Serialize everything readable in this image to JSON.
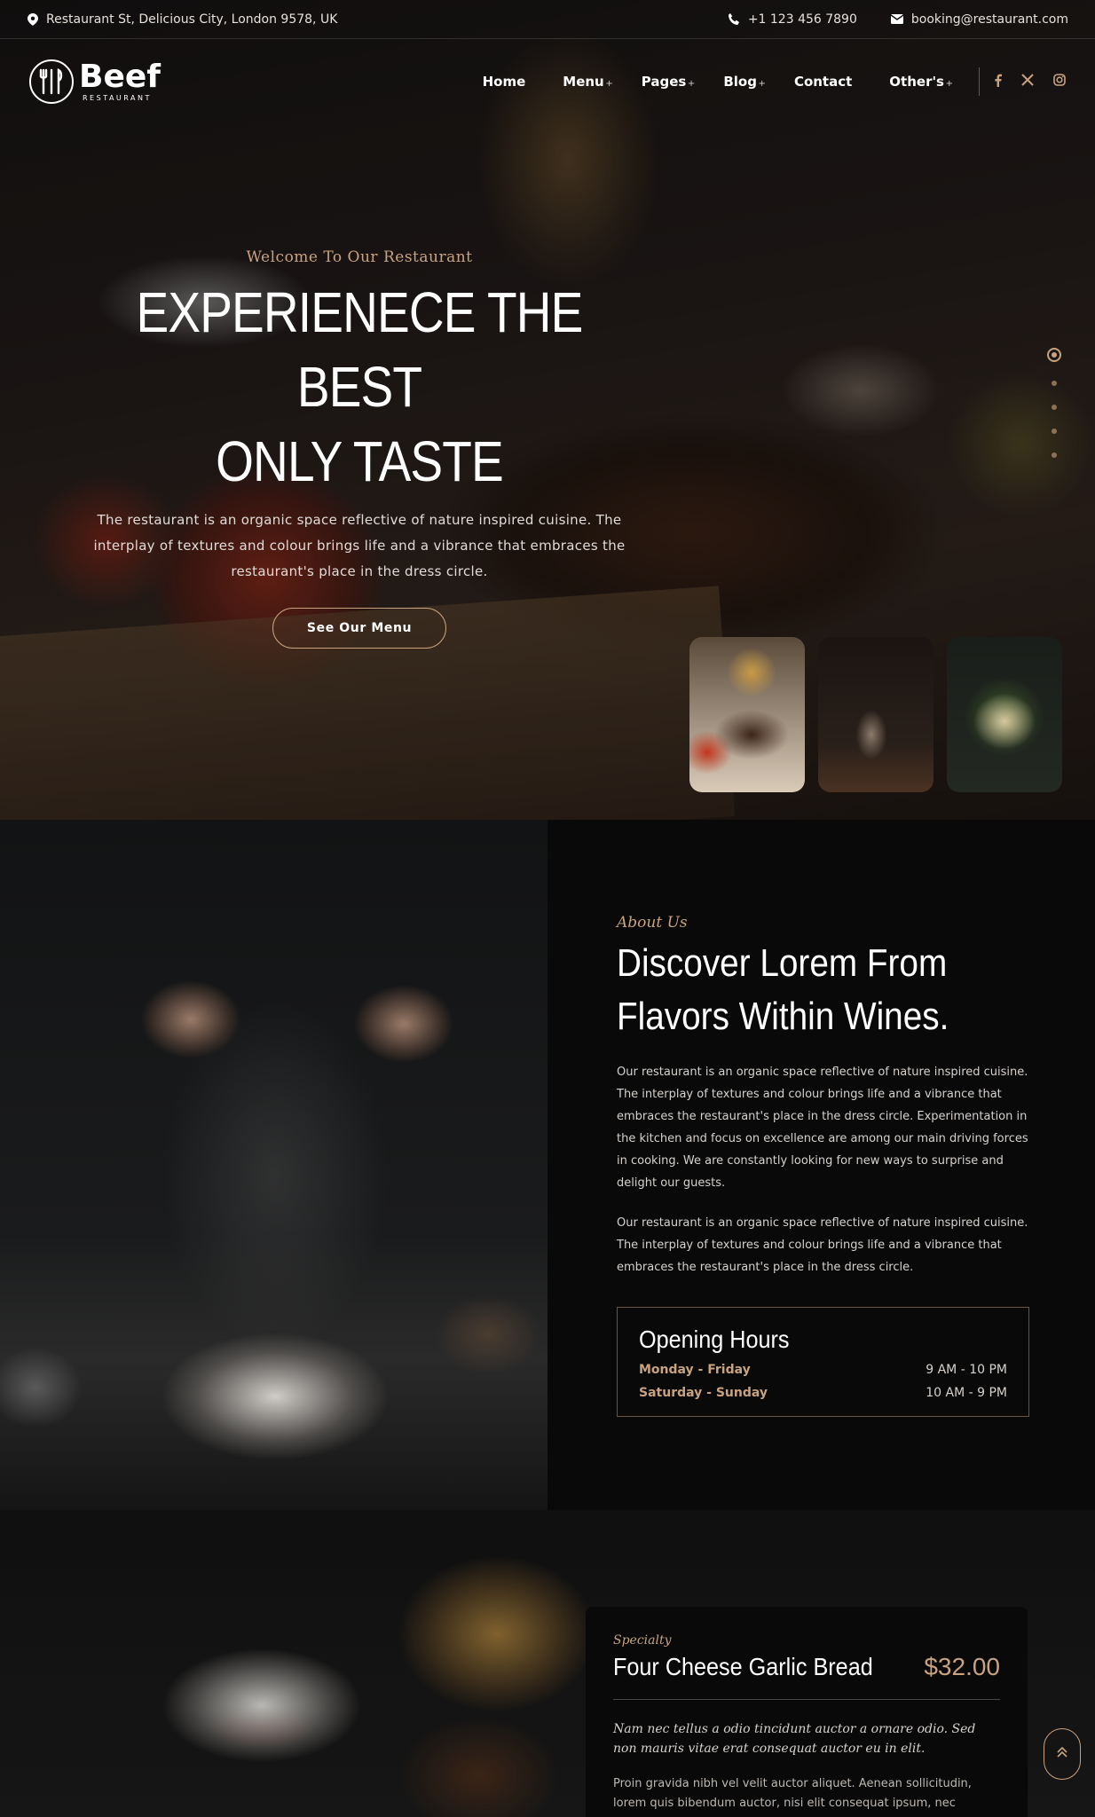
{
  "topbar": {
    "address": "Restaurant St, Delicious City, London 9578, UK",
    "phone": "+1 123 456 7890",
    "email": "booking@restaurant.com",
    "icons": {
      "address": "map-pin-icon",
      "phone": "phone-icon",
      "email": "envelope-icon"
    }
  },
  "brand": {
    "name": "Beef",
    "tagline": "RESTAURANT"
  },
  "nav": {
    "items": [
      {
        "label": "Home",
        "dropdown": false
      },
      {
        "label": "Menu",
        "dropdown": true
      },
      {
        "label": "Pages",
        "dropdown": true
      },
      {
        "label": "Blog",
        "dropdown": true
      },
      {
        "label": "Contact",
        "dropdown": false
      },
      {
        "label": "Other's",
        "dropdown": true
      }
    ],
    "social": [
      "facebook-icon",
      "x-icon",
      "instagram-icon"
    ]
  },
  "hero": {
    "welcome": "Welcome To Our Restaurant",
    "title_line1": "EXPERIENECE THE BEST",
    "title_line2": "ONLY TASTE",
    "description": "The restaurant is an organic space reflective of nature inspired cuisine. The interplay of textures and colour brings life and a vibrance that embraces the restaurant's place in the dress circle.",
    "cta": "See Our Menu",
    "slides": 5,
    "active_slide": 1
  },
  "about": {
    "eyebrow": "About Us",
    "title": "Discover Lorem From Flavors Within Wines.",
    "paragraph1": "Our restaurant is an organic space reflective of nature inspired cuisine. The interplay of textures and colour brings life and a vibrance that embraces the restaurant's place in the dress circle. Experimentation in the kitchen and focus on excellence are among our main driving forces in cooking. We are constantly looking for new ways to surprise and delight our guests.",
    "paragraph2": "Our restaurant is an organic space reflective of nature inspired cuisine. The interplay of textures and colour brings life and a vibrance that embraces the restaurant's place in the dress circle.",
    "hours": {
      "title": "Opening Hours",
      "rows": [
        {
          "day": "Monday - Friday",
          "time": "9 AM - 10 PM"
        },
        {
          "day": "Saturday - Sunday",
          "time": "10 AM - 9 PM"
        }
      ]
    }
  },
  "specialty": {
    "eyebrow": "Specialty",
    "name": "Four Cheese Garlic Bread",
    "price": "$32.00",
    "quote": "Nam nec tellus a odio tincidunt auctor a ornare odio. Sed non mauris vitae erat consequat auctor eu in elit.",
    "text": "Proin gravida nibh vel velit auctor aliquet. Aenean sollicitudin, lorem quis bibendum auctor, nisi elit consequat ipsum, nec sagittis sem nibh id elit."
  },
  "colors": {
    "accent": "#c9a27e",
    "background": "#0b0b0c"
  }
}
